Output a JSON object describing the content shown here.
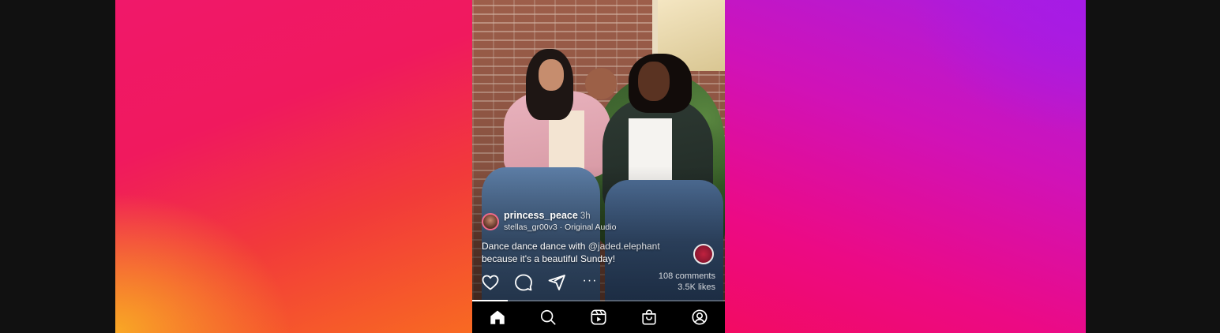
{
  "post": {
    "username": "princess_peace",
    "time": "3h",
    "audio": "stellas_gr00v3 · Original Audio",
    "caption_start": "Dance dance dance with ",
    "caption_mention": "@jaded.elephant",
    "caption_end": " because it's a beautiful Sunday!",
    "comments": "108 comments",
    "likes": "3.5K likes",
    "more_label": "···",
    "video_progress": 0.14
  },
  "actions": {
    "icons": [
      "heart-icon",
      "comment-icon",
      "share-icon",
      "more-icon"
    ]
  },
  "nav": {
    "icons": [
      "home-icon",
      "search-icon",
      "reels-icon",
      "shop-icon",
      "profile-icon"
    ]
  },
  "colors": {
    "accent_left_top": "#f0186a",
    "accent_left_bottom": "#f9a825",
    "accent_right_top": "#a81ee0",
    "accent_right_bottom": "#f20b62",
    "nav_bg": "#000000"
  }
}
